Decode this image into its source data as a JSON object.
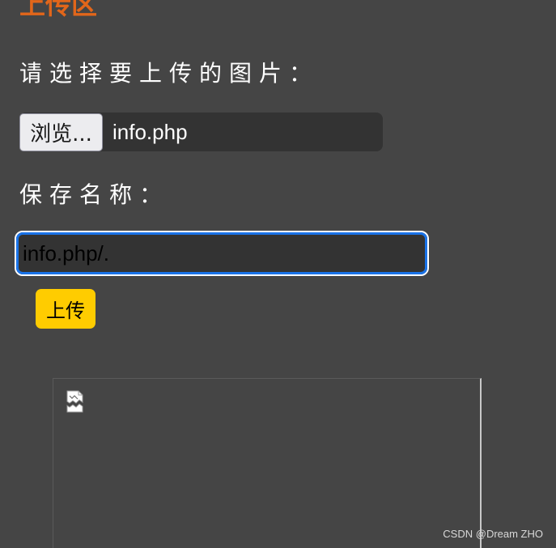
{
  "section": {
    "title": "上传区"
  },
  "form": {
    "select_label": "请选择要上传的图片：",
    "browse_label": "浏览...",
    "selected_file": "info.php",
    "save_name_label": "保存名称：",
    "save_name_value": "info.php/.",
    "upload_label": "上传"
  },
  "preview": {
    "icon": "broken-image-icon"
  },
  "watermark": "CSDN @Dream ZHO",
  "colors": {
    "background": "#454545",
    "title": "#e2661a",
    "upload_button": "#ffcc00",
    "focus_ring": "#1a73e8"
  }
}
